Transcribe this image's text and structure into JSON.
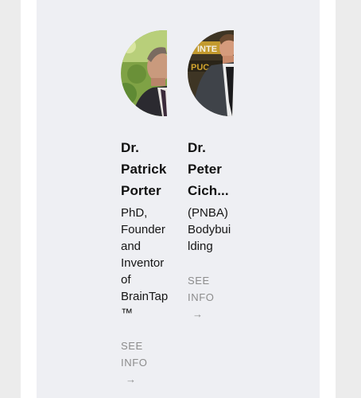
{
  "people": [
    {
      "name_lines": [
        "Dr.",
        "Patrick",
        "Porter"
      ],
      "title_lines": [
        "PhD,",
        "Founder",
        "and",
        "Inventor",
        "of",
        "BrainTap",
        "™"
      ],
      "link_lines": [
        "SEE",
        "INFO"
      ],
      "arrow_icon": "arrow-right-icon"
    },
    {
      "name_lines": [
        "Dr.",
        "Peter",
        "Cich..."
      ],
      "title_lines": [
        "(PNBA)",
        "Bodybui",
        "lding"
      ],
      "link_lines": [
        "SEE",
        "INFO"
      ],
      "arrow_icon": "arrow-right-icon",
      "photo_sign_text": [
        "INTE",
        "PUC"
      ]
    }
  ],
  "colors": {
    "panel_bg": "#eeeff3",
    "link_gray": "#8c8c8c"
  }
}
